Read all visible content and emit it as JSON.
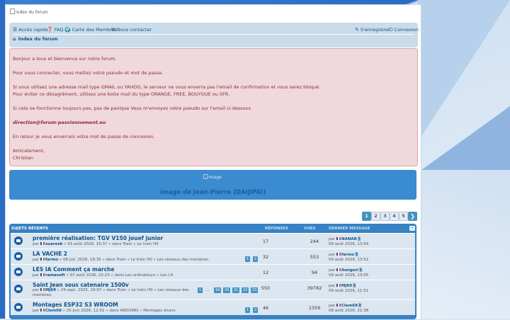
{
  "header": {
    "logo_alt": "index du forum"
  },
  "nav": {
    "quick_access": "Accès rapide",
    "faq": "FAQ",
    "members": "Carte des Membres",
    "contact": "Nous contacter",
    "register": "S'enregistrer",
    "login": "Connexion",
    "breadcrumb": "Index du forum"
  },
  "notice": {
    "line1": "Bonjour a tous et bienvenus sur notre forum.",
    "line2": "Pour vous connecter, vous mettez votre pseudo et mot de passe.",
    "line3": "Si vous utilisez une adresse mail type GMAIL ou YAHOO, le serveur ne vous enverra pas l'email de confirmation et vous serez bloqué.",
    "line4": "Pour éviter ce désagrément, utilisez une boite mail du type ORANGE, FREE, BOUYGUE ou SFR.",
    "line5": "Si cela ne fonctionne toujours pas, pas de panique Vous m'envoyez votre pseudo sur l'email ci-dessous",
    "email": "direction@forum-passionnement.eu",
    "line6": "En retour je vous enverrais votre mot de passe de connexion.",
    "line7": "Amicalement,",
    "line8": "Christian"
  },
  "banner": {
    "img_alt": "image",
    "caption": "image de Jean-Pierre (DAIJIPAI)"
  },
  "pagination": {
    "pages": [
      "1",
      "2",
      "3",
      "4",
      "5"
    ],
    "next": "❯"
  },
  "topics_header": {
    "title": "SUJETS RÉCENTS",
    "replies": "RÉPONSES",
    "views": "VUES",
    "last_post": "DERNIER MESSAGE",
    "collapse": "−"
  },
  "topics": [
    {
      "title": "première réalisation: TGV V150 jouef junior",
      "by": "par",
      "author": "suarezb",
      "meta": "» 03 août 2026, 16:37 » dans Train » Le train H0",
      "replies": "17",
      "views": "244",
      "last_by": "par",
      "last_author": "NANAR",
      "last_date": "09 août 2026, 13:54"
    },
    {
      "title": "LA VACHE 2",
      "by": "par",
      "author": "farmo",
      "meta": "» 08 juil. 2026, 18:35 » dans Train » Le train H0 » Les réseaux des membres.",
      "pages": [
        "1",
        "2"
      ],
      "replies": "32",
      "views": "553",
      "last_by": "par",
      "last_author": "farmo",
      "last_date": "09 août 2026, 13:52"
    },
    {
      "title": "LES IA Comment ça marche",
      "by": "par",
      "author": "ramasoft",
      "meta": "» 07 août 2026, 22:23 » dans Les ordinateurs » Les I.A",
      "replies": "12",
      "views": "94",
      "last_by": "par",
      "last_author": "Amigori",
      "last_date": "09 août 2026, 13:05"
    },
    {
      "title": "Saint Jean sous catenaire 1500v",
      "by": "par",
      "author": "MJ60",
      "meta": "» 29 sept. 2025, 19:07 » dans Train » Le train H0 » Les réseaux des membres.",
      "pages": [
        "1",
        "...",
        "19",
        "20",
        "21",
        "22",
        "23"
      ],
      "replies": "550",
      "views": "39782",
      "last_by": "par",
      "last_author": "MJ60",
      "last_date": "09 août 2026, 11:51"
    },
    {
      "title": "Montages ESP32 S3 WROOM",
      "by": "par",
      "author": "Clem68",
      "meta": "» 25 juin 2026, 12:01 » dans ARDUINO » Montages divers",
      "pages": [
        "1",
        "2"
      ],
      "replies": "46",
      "views": "1359",
      "last_by": "par",
      "last_author": "Clem68",
      "last_date": "08 août 2026, 21:38"
    }
  ]
}
